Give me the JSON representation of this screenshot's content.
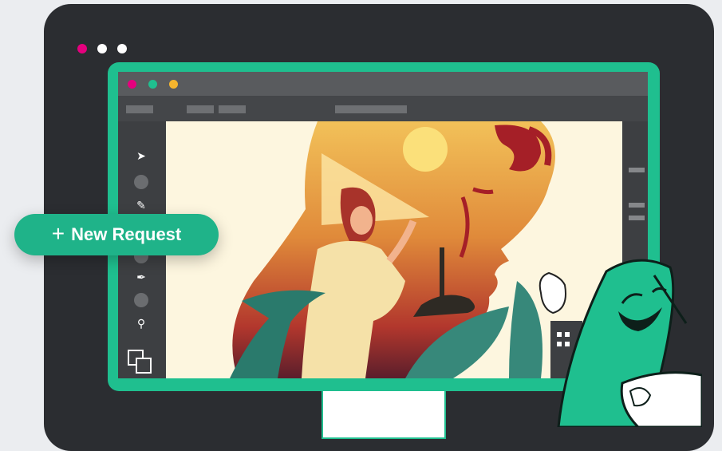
{
  "device": {
    "dots": [
      "#e5007e",
      "#ffffff",
      "#ffffff"
    ]
  },
  "app_window": {
    "traffic_lights": [
      "#e5007e",
      "#1fbf8f",
      "#f5b52e"
    ],
    "tools": [
      "selection-arrow",
      "circle",
      "brush",
      "circle",
      "circle",
      "pen-nib",
      "circle",
      "zoom-magnifier",
      "fill-stroke-swatch"
    ]
  },
  "colors": {
    "accent": "#1fb389",
    "device_frame": "#2b2d31",
    "monitor_border": "#1fbf8f"
  },
  "cta": {
    "icon": "plus-icon",
    "label": "New Request"
  }
}
